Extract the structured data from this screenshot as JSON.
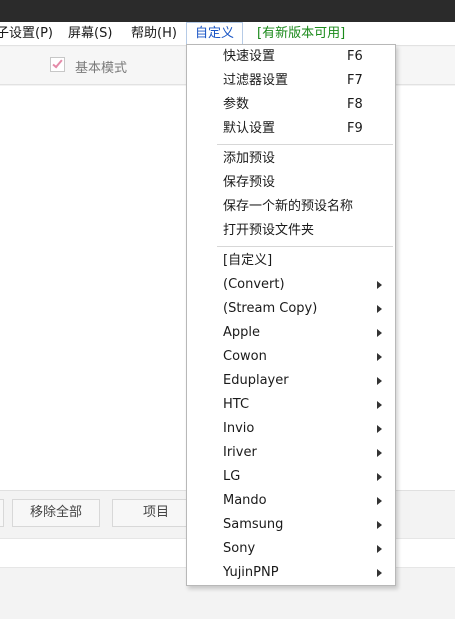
{
  "menubar": {
    "items": [
      {
        "label": "子设置(P)"
      },
      {
        "label": "屏幕(S)"
      },
      {
        "label": "帮助(H)"
      },
      {
        "label": "自定义"
      },
      {
        "label": "[有新版本可用]"
      }
    ]
  },
  "toolbar": {
    "basic_mode_label": "基本模式",
    "basic_mode_checked": true
  },
  "bottom_buttons": [
    {
      "label": "移除全部"
    },
    {
      "label": "项目"
    }
  ],
  "custom_menu": {
    "group1": [
      {
        "label": "快速设置",
        "shortcut": "F6"
      },
      {
        "label": "过滤器设置",
        "shortcut": "F7"
      },
      {
        "label": "参数",
        "shortcut": "F8"
      },
      {
        "label": "默认设置",
        "shortcut": "F9"
      }
    ],
    "group2": [
      {
        "label": "添加预设"
      },
      {
        "label": "保存预设"
      },
      {
        "label": "保存一个新的预设名称"
      },
      {
        "label": "打开预设文件夹"
      }
    ],
    "group3": [
      {
        "label": "[自定义]",
        "submenu": false
      },
      {
        "label": "(Convert)",
        "submenu": true
      },
      {
        "label": "(Stream Copy)",
        "submenu": true
      },
      {
        "label": "Apple",
        "submenu": true
      },
      {
        "label": "Cowon",
        "submenu": true
      },
      {
        "label": "Eduplayer",
        "submenu": true
      },
      {
        "label": "HTC",
        "submenu": true
      },
      {
        "label": "Invio",
        "submenu": true
      },
      {
        "label": "Iriver",
        "submenu": true
      },
      {
        "label": "LG",
        "submenu": true
      },
      {
        "label": "Mando",
        "submenu": true
      },
      {
        "label": "Samsung",
        "submenu": true
      },
      {
        "label": "Sony",
        "submenu": true
      },
      {
        "label": "YujinPNP",
        "submenu": true
      }
    ]
  },
  "colors": {
    "accent": "#1a56c5",
    "update_link": "#1b8a1b",
    "checkmark": "#e48aa8"
  }
}
